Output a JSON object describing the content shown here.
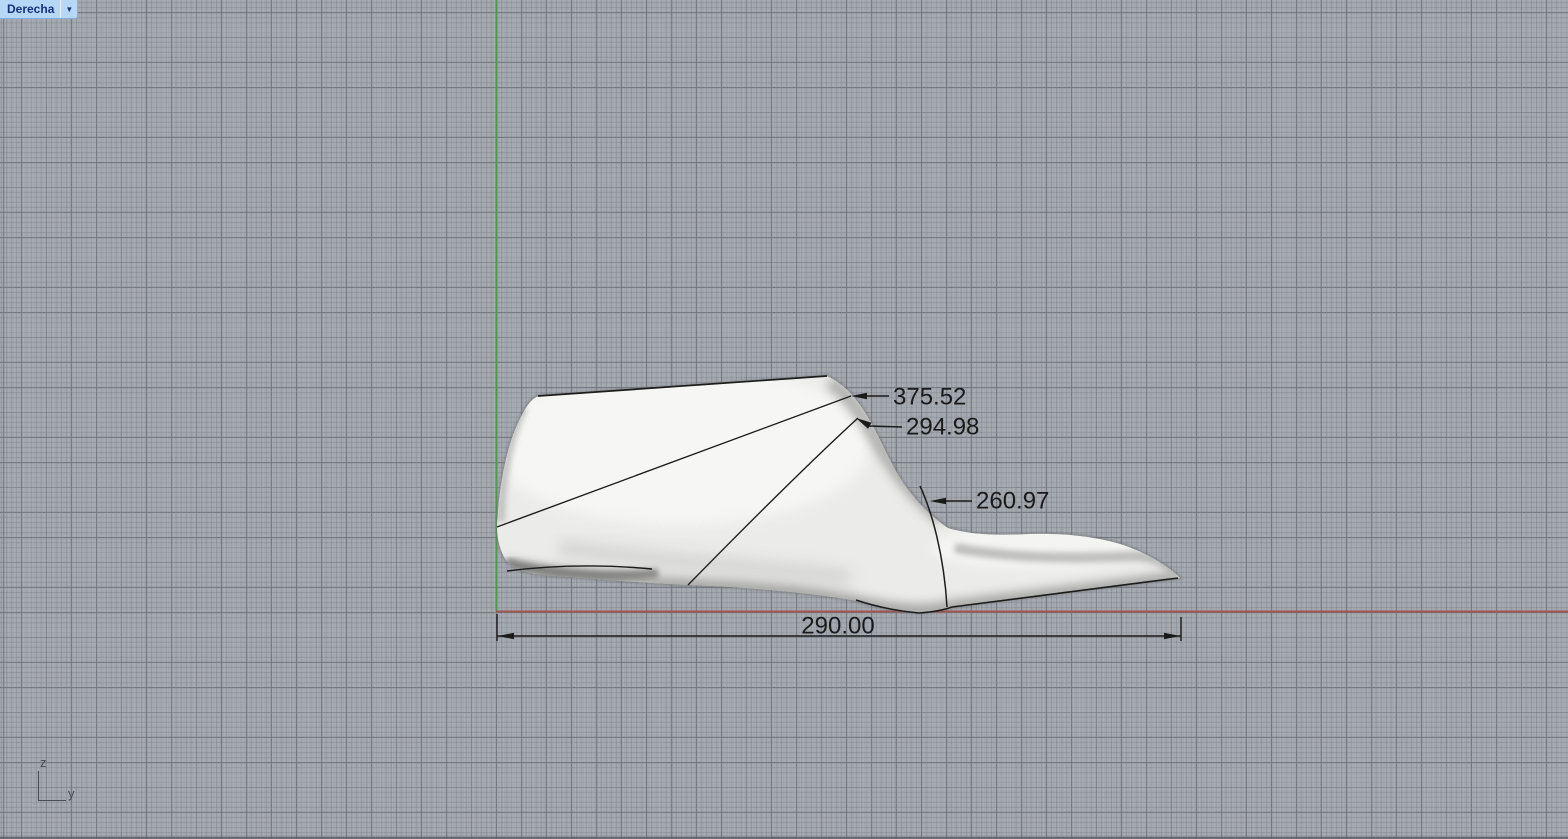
{
  "viewport": {
    "title": "Derecha",
    "dropdown_icon": "▼"
  },
  "dimensions": {
    "leaders": [
      {
        "label": "375.52"
      },
      {
        "label": "294.98"
      },
      {
        "label": "260.97"
      }
    ],
    "linear": {
      "label": "290.00"
    }
  },
  "axis_indicator": {
    "vertical": "z",
    "horizontal": "y"
  },
  "colors": {
    "background": "#a3a7ae",
    "grid_major": "#70747e",
    "axis_vertical_green": "#4d9a4d",
    "axis_horizontal_red": "#a0544e",
    "tab_background": "#b7d7f6",
    "tab_text": "#16317d",
    "dimension_color": "#1a1a1a",
    "model_fill": "#ebebe9"
  }
}
